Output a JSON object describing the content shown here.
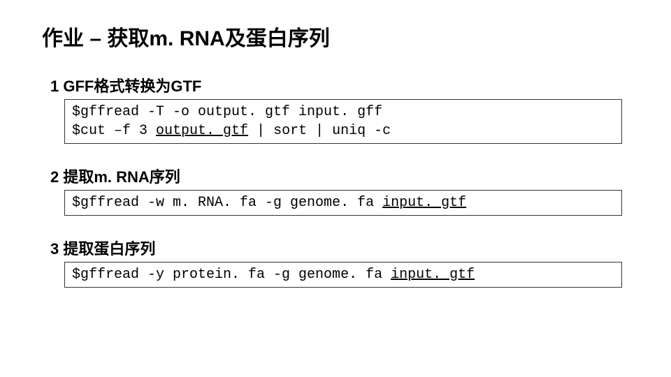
{
  "title": "作业 – 获取m. RNA及蛋白序列",
  "sections": [
    {
      "heading": "1 GFF格式转换为GTF",
      "lines": [
        {
          "prefix": "$gffread -T -o output. gtf input. gff",
          "underlined": ""
        },
        {
          "prefix": "$cut –f 3 ",
          "underlined": "output. gtf",
          "suffix": " | sort | uniq -c"
        }
      ]
    },
    {
      "heading": "2 提取m. RNA序列",
      "lines": [
        {
          "prefix": "$gffread -w m. RNA. fa -g genome. fa ",
          "underlined": "input. gtf"
        }
      ]
    },
    {
      "heading": "3 提取蛋白序列",
      "lines": [
        {
          "prefix": "$gffread -y protein. fa -g genome. fa ",
          "underlined": "input. gtf"
        }
      ]
    }
  ]
}
